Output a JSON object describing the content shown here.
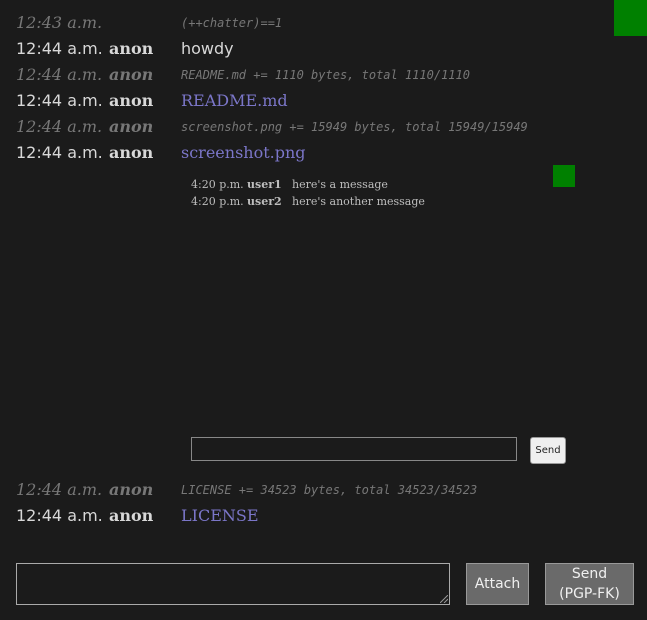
{
  "messages": [
    {
      "time": "12:43 a.m.",
      "user": "",
      "text": "(++chatter)==1",
      "kind": "system"
    },
    {
      "time": "12:44 a.m.",
      "user": "anon",
      "text": "howdy",
      "kind": "normal"
    },
    {
      "time": "12:44 a.m.",
      "user": "anon",
      "text": "README.md += 1110 bytes, total 1110/1110",
      "kind": "system"
    },
    {
      "time": "12:44 a.m.",
      "user": "anon",
      "text": "README.md",
      "kind": "link"
    },
    {
      "time": "12:44 a.m.",
      "user": "anon",
      "text": "screenshot.png += 15949 bytes, total 15949/15949",
      "kind": "system"
    },
    {
      "time": "12:44 a.m.",
      "user": "anon",
      "text": "screenshot.png",
      "kind": "link"
    },
    {
      "time": "12:44 a.m.",
      "user": "anon",
      "text": "LICENSE += 34523 bytes, total 34523/34523",
      "kind": "system"
    },
    {
      "time": "12:44 a.m.",
      "user": "anon",
      "text": "LICENSE",
      "kind": "link"
    }
  ],
  "embed": {
    "messages": [
      {
        "time": "4:20 p.m.",
        "user": "user1",
        "text": "here's a message"
      },
      {
        "time": "4:20 p.m.",
        "user": "user2",
        "text": "here's another message"
      }
    ],
    "send_label": "Send"
  },
  "composer": {
    "attach_label": "Attach",
    "send_label_line1": "Send",
    "send_label_line2": "(PGP-FK)"
  },
  "colors": {
    "background": "#1b1b1b",
    "link": "#7b76c8",
    "indicator": "#008000"
  }
}
